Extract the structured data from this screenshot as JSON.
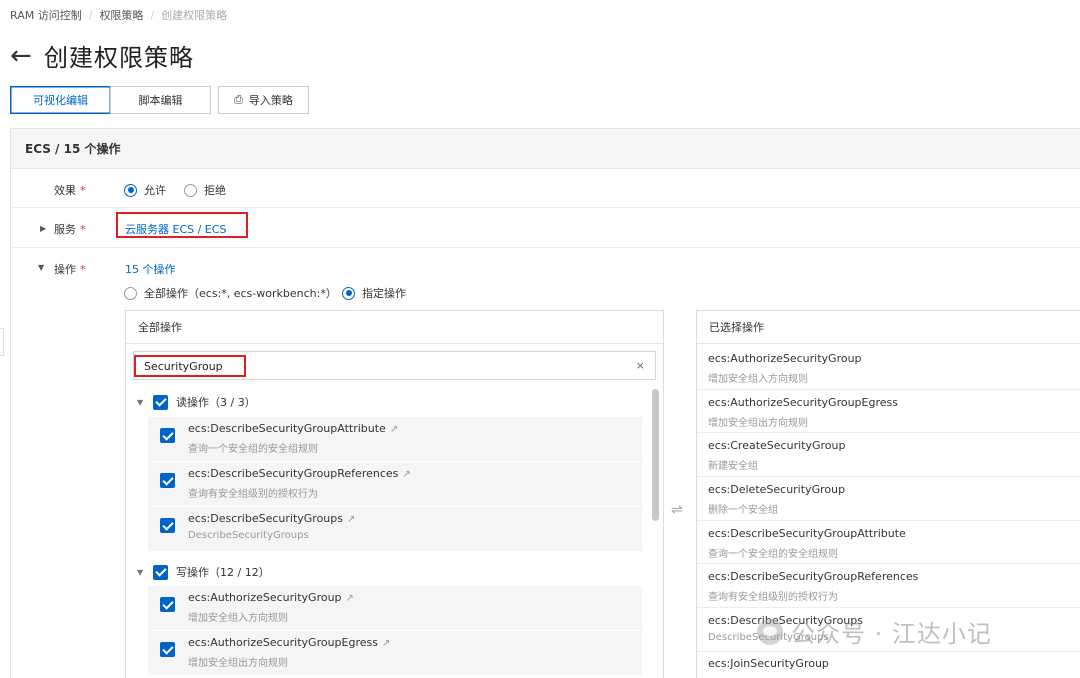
{
  "breadcrumb": [
    "RAM 访问控制",
    "权限策略",
    "创建权限策略"
  ],
  "page": {
    "back_icon": "arrow-left-icon",
    "title": "创建权限策略"
  },
  "tabs": {
    "visual": "可视化编辑",
    "script": "脚本编辑",
    "import": "导入策略",
    "import_icon": "import-icon"
  },
  "policy": {
    "header": "ECS / 15 个操作",
    "effect": {
      "label": "效果",
      "required": "*",
      "allow": "允许",
      "deny": "拒绝",
      "selected": "允许"
    },
    "service": {
      "label": "服务",
      "required": "*",
      "value": "云服务器 ECS / ECS"
    },
    "action": {
      "label": "操作",
      "required": "*",
      "count": "15 个操作",
      "all_option": "全部操作（ecs:*, ecs-workbench:*）",
      "specific_option": "指定操作",
      "selected": "指定操作"
    }
  },
  "all_actions": {
    "title": "全部操作",
    "search_value": "SecurityGroup",
    "clear_icon": "×",
    "groups": [
      {
        "label": "读操作（3 / 3）",
        "items": [
          {
            "name": "ecs:DescribeSecurityGroupAttribute",
            "desc": "查询一个安全组的安全组规则"
          },
          {
            "name": "ecs:DescribeSecurityGroupReferences",
            "desc": "查询有安全组级别的授权行为"
          },
          {
            "name": "ecs:DescribeSecurityGroups",
            "desc": "DescribeSecurityGroups"
          }
        ]
      },
      {
        "label": "写操作（12 / 12）",
        "items": [
          {
            "name": "ecs:AuthorizeSecurityGroup",
            "desc": "增加安全组入方向规则"
          },
          {
            "name": "ecs:AuthorizeSecurityGroupEgress",
            "desc": "增加安全组出方向规则"
          }
        ]
      }
    ],
    "external_link_icon": "↗"
  },
  "transfer_icon": "⇌",
  "selected_actions": {
    "title": "已选择操作",
    "items": [
      {
        "name": "ecs:AuthorizeSecurityGroup",
        "desc": "增加安全组入方向规则"
      },
      {
        "name": "ecs:AuthorizeSecurityGroupEgress",
        "desc": "增加安全组出方向规则"
      },
      {
        "name": "ecs:CreateSecurityGroup",
        "desc": "新建安全组"
      },
      {
        "name": "ecs:DeleteSecurityGroup",
        "desc": "删除一个安全组"
      },
      {
        "name": "ecs:DescribeSecurityGroupAttribute",
        "desc": "查询一个安全组的安全组规则"
      },
      {
        "name": "ecs:DescribeSecurityGroupReferences",
        "desc": "查询有安全组级别的授权行为"
      },
      {
        "name": "ecs:DescribeSecurityGroups",
        "desc": "DescribeSecurityGroups"
      },
      {
        "name": "ecs:JoinSecurityGroup",
        "desc": ""
      }
    ]
  },
  "watermark": "公众号 · 江达小记",
  "colors": {
    "accent": "#0064c8",
    "highlight_box": "#e02020",
    "required": "#e0292a"
  }
}
